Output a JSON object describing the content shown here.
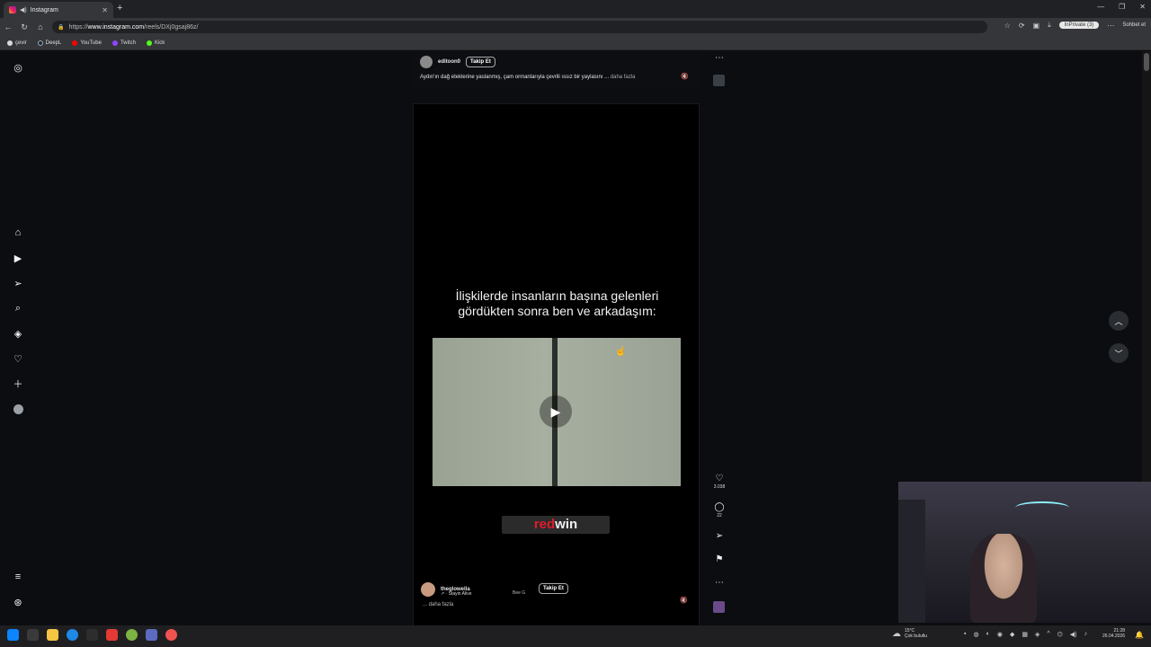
{
  "browser": {
    "tab_title": "Instagram",
    "tab_close": "✕",
    "new_tab": "+",
    "url_prefix": "https://",
    "url_host": "www.instagram.com",
    "url_path": "/reels/DXj0gsaj86z/",
    "inprivate_label": "InPrivate (3)",
    "chat_label": "Sohbet et",
    "bookmarks": [
      {
        "label": "çevir",
        "color": "#d9d9d9"
      },
      {
        "label": "DeepL",
        "color": "#0f2b46"
      },
      {
        "label": "YouTube",
        "color": "#ff0000"
      },
      {
        "label": "Twitch",
        "color": "#9146ff"
      },
      {
        "label": "Kick",
        "color": "#53fc18"
      }
    ]
  },
  "reel_top": {
    "username": "editoon0",
    "follow_label": "Takip Et",
    "caption": "Aydın'ın dağ eteklerine yaslanmış, çam ormanlarıyla çevrili ıssız bir yaylasını ...",
    "more_label": "daha fazla"
  },
  "reel_main": {
    "overlay_line1": "İlişkilerde insanların başına gelenleri",
    "overlay_line2": "gördükten sonra ben ve arkadaşım:",
    "brand_red": "red",
    "brand_white": "win",
    "username": "theglowella",
    "music": "↗ · Stayin Alive",
    "music_extra": "Bee G",
    "follow_label": "Takip Et",
    "more_label": "... daha fazla"
  },
  "actions": {
    "likes": "3.038",
    "comments": "22"
  },
  "taskbar": {
    "temperature": "15°C",
    "weather_desc": "Çok bulutlu",
    "time": "21:28",
    "date": "26.04.2026"
  },
  "colors": {
    "background": "#0b0d10",
    "brand_red": "#e01c2d",
    "accent": "#8ef0ff"
  }
}
